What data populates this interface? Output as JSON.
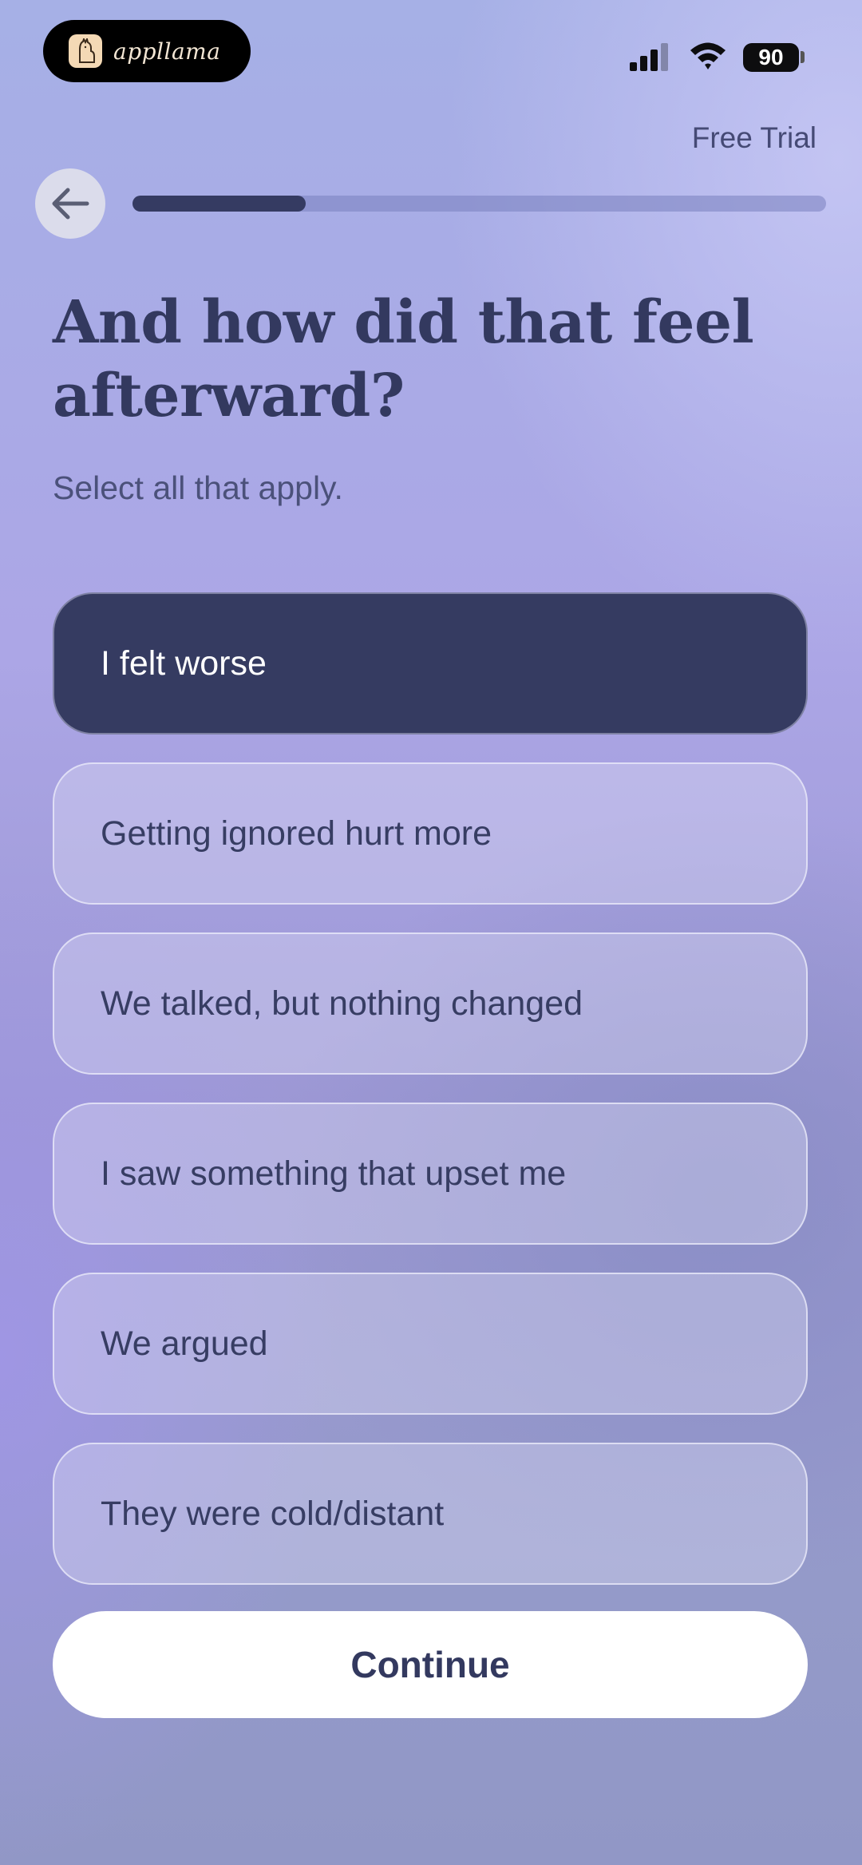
{
  "status_bar": {
    "brand": "appllama",
    "battery": "90"
  },
  "header": {
    "free_trial": "Free Trial",
    "progress": 0.25
  },
  "question": {
    "title": "And how did that feel afterward?",
    "subtitle": "Select all that apply."
  },
  "options": [
    {
      "label": "I felt worse",
      "selected": true
    },
    {
      "label": "Getting ignored hurt more",
      "selected": false
    },
    {
      "label": "We talked, but nothing changed",
      "selected": false
    },
    {
      "label": "I saw something that upset me",
      "selected": false
    },
    {
      "label": "We argued",
      "selected": false
    },
    {
      "label": "They were cold/distant",
      "selected": false
    }
  ],
  "continue_label": "Continue",
  "colors": {
    "accent": "#353b61",
    "text": "#33395f"
  }
}
